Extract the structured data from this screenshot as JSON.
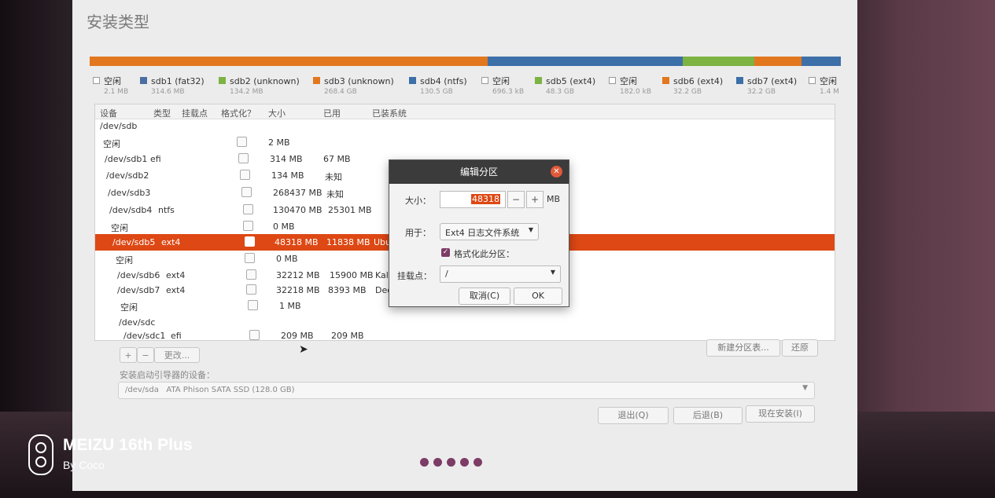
{
  "colors": {
    "accent": "#dd4814",
    "fat32": "#4a6fa0",
    "unknown_green": "#7cb342",
    "unknown_orange": "#e2771e",
    "ntfs": "#3d6fa8",
    "ext4_green": "#7cb342",
    "ext4_orange": "#e2771e",
    "ext4_blue": "#3d6fa8",
    "free": "#ffffff"
  },
  "window": {
    "title": "安装类型"
  },
  "legend": [
    {
      "name": "空闲",
      "size": "2.1 MB",
      "swatch": "free"
    },
    {
      "name": "sdb1 (fat32)",
      "size": "314.6 MB",
      "swatch": "fat32"
    },
    {
      "name": "sdb2 (unknown)",
      "size": "134.2 MB",
      "swatch": "unknown_green"
    },
    {
      "name": "sdb3 (unknown)",
      "size": "268.4 GB",
      "swatch": "unknown_orange"
    },
    {
      "name": "sdb4 (ntfs)",
      "size": "130.5 GB",
      "swatch": "ntfs"
    },
    {
      "name": "空闲",
      "size": "696.3 kB",
      "swatch": "free"
    },
    {
      "name": "sdb5 (ext4)",
      "size": "48.3 GB",
      "swatch": "ext4_green"
    },
    {
      "name": "空闲",
      "size": "182.0 kB",
      "swatch": "free"
    },
    {
      "name": "sdb6 (ext4)",
      "size": "32.2 GB",
      "swatch": "ext4_orange"
    },
    {
      "name": "sdb7 (ext4)",
      "size": "32.2 GB",
      "swatch": "ext4_blue"
    },
    {
      "name": "空闲",
      "size": "1.4 M",
      "swatch": "free"
    }
  ],
  "table": {
    "headers": {
      "device": "设备",
      "type": "类型",
      "mount": "挂载点",
      "format": "格式化？",
      "size": "大小",
      "used": "已用",
      "system": "已装系统"
    },
    "rows": [
      {
        "device": "/dev/sdb",
        "type": "",
        "size": "",
        "used": "",
        "system": "",
        "checkbox": false
      },
      {
        "device": "空闲",
        "type": "",
        "size": "2 MB",
        "used": "",
        "system": "",
        "checkbox": true
      },
      {
        "device": "/dev/sdb1",
        "type": "efi",
        "size": "314 MB",
        "used": "67 MB",
        "system": "",
        "checkbox": true
      },
      {
        "device": "/dev/sdb2",
        "type": "",
        "size": "134 MB",
        "used": "未知",
        "system": "",
        "checkbox": true
      },
      {
        "device": "/dev/sdb3",
        "type": "",
        "size": "268437 MB",
        "used": "未知",
        "system": "",
        "checkbox": true
      },
      {
        "device": "/dev/sdb4",
        "type": "ntfs",
        "size": "130470 MB",
        "used": "25301 MB",
        "system": "",
        "checkbox": true
      },
      {
        "device": "空闲",
        "type": "",
        "size": "0 MB",
        "used": "",
        "system": "",
        "checkbox": true
      },
      {
        "device": "/dev/sdb5",
        "type": "ext4",
        "size": "48318 MB",
        "used": "11838 MB",
        "system": "Ubu",
        "checkbox": true,
        "selected": true
      },
      {
        "device": "空闲",
        "type": "",
        "size": "0 MB",
        "used": "",
        "system": "",
        "checkbox": true
      },
      {
        "device": "/dev/sdb6",
        "type": "ext4",
        "size": "32212 MB",
        "used": "15900 MB",
        "system": "Kali",
        "checkbox": true
      },
      {
        "device": "/dev/sdb7",
        "type": "ext4",
        "size": "32218 MB",
        "used": "8393 MB",
        "system": "Dee",
        "checkbox": true
      },
      {
        "device": "空闲",
        "type": "",
        "size": "1 MB",
        "used": "",
        "system": "",
        "checkbox": true
      },
      {
        "device": "/dev/sdc",
        "type": "",
        "size": "",
        "used": "",
        "system": "",
        "checkbox": false
      },
      {
        "device": "/dev/sdc1",
        "type": "efi",
        "size": "209 MB",
        "used": "209 MB",
        "system": "",
        "checkbox": true
      }
    ]
  },
  "toolbar": {
    "add": "+",
    "remove": "−",
    "change": "更改...",
    "new_table": "新建分区表...",
    "revert": "还原"
  },
  "boot": {
    "label": "安装启动引导器的设备：",
    "device": "/dev/sda",
    "model": "ATA Phison SATA SSD (128.0 GB)"
  },
  "nav": {
    "quit": "退出(Q)",
    "back": "后退(B)",
    "install_now": "现在安装(I)"
  },
  "progress": {
    "total": 7,
    "current": 5
  },
  "dialog": {
    "title": "编辑分区",
    "size_label": "大小：",
    "size_value": "48318",
    "size_unit": "MB",
    "minus": "−",
    "plus": "+",
    "use_label": "用于：",
    "use_value": "Ext4 日志文件系统",
    "format_label": "格式化此分区：",
    "format_checked": true,
    "mount_label": "挂载点：",
    "mount_value": "/",
    "cancel": "取消(C)",
    "ok": "OK"
  },
  "watermark": {
    "brand": "MEIZU 16th Plus",
    "sub": "By Coco"
  }
}
